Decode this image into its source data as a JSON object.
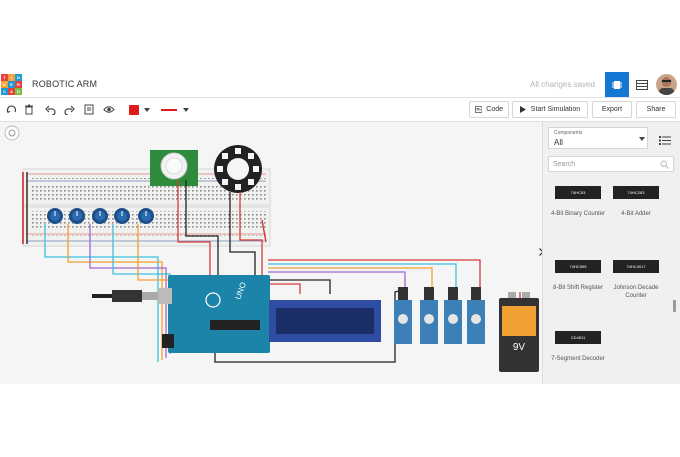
{
  "header": {
    "logo_letters": [
      "TIN",
      "KER",
      "CAD"
    ],
    "title": "ROBOTIC ARM",
    "save_status": "All changes saved"
  },
  "toolbar": {
    "code_label": "Code",
    "start_simulation_label": "Start Simulation",
    "export_label": "Export",
    "share_label": "Share",
    "fill_color": "#e01b1b",
    "line_color": "#e01b1b"
  },
  "panel": {
    "components_caption": "Components",
    "components_value": "All",
    "search_placeholder": "Search",
    "components": [
      {
        "chip": "74HC93",
        "label": "4-Bit Binary Counter"
      },
      {
        "chip": "74HC283",
        "label": "4-Bit Adder"
      },
      {
        "chip": "74HC595",
        "label": "8-Bit Shift Register"
      },
      {
        "chip": "74HC4017",
        "label": "Johnson Decade Counter"
      },
      {
        "chip": "CD4511",
        "label": "7-Segment Decoder"
      }
    ]
  },
  "canvas": {
    "arduino_label": "UNO",
    "battery_label": "9V"
  },
  "colors": {
    "accent": "#1477d4",
    "wire_orange": "#f0a030",
    "wire_cyan": "#3cc1e0",
    "wire_red": "#d63b3b",
    "wire_purple": "#a066d0",
    "wire_black": "#222222",
    "arduino": "#1b84a8",
    "lcd": "#2f4ea3",
    "servo": "#3d7fb7",
    "pir": "#2e8b3c"
  }
}
